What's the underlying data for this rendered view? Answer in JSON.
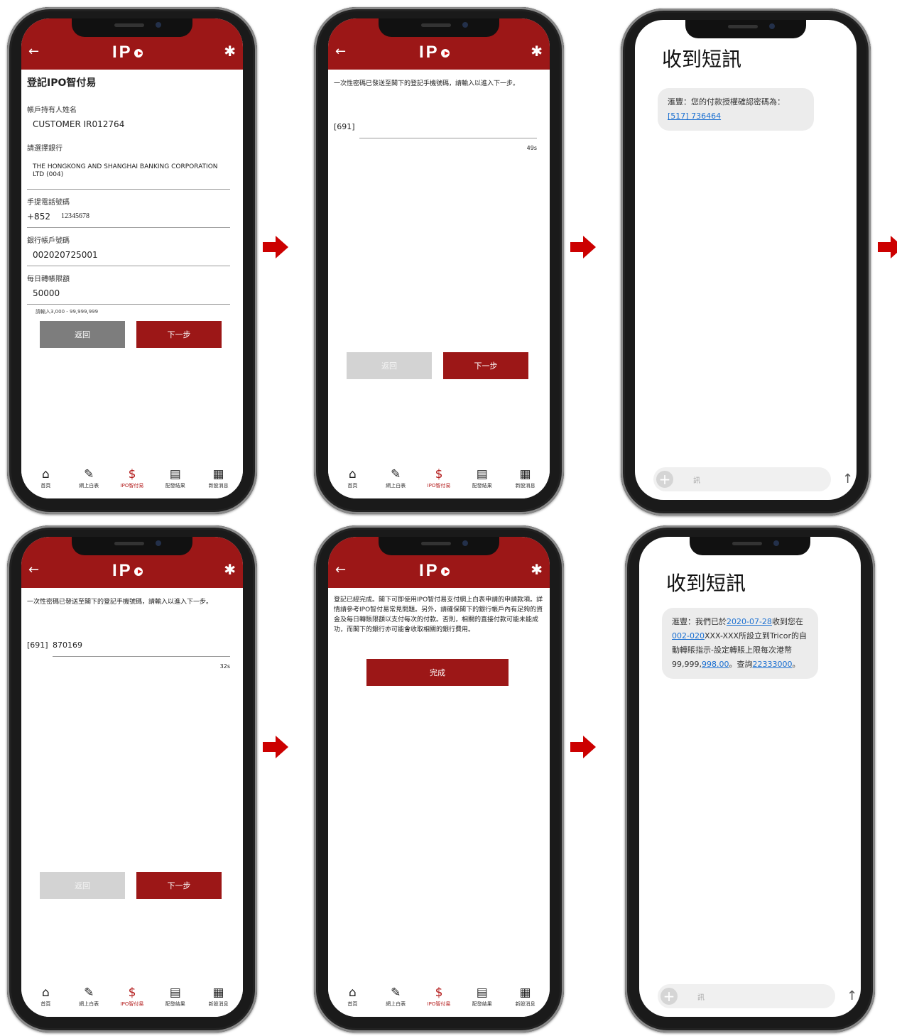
{
  "app": {
    "logo_text": "IP",
    "back_icon": "arrow-left-icon",
    "settings_icon": "gear-icon",
    "brand_color": "#9c1717"
  },
  "tabs": [
    {
      "icon": "home-icon",
      "glyph": "⌂",
      "label": "首頁"
    },
    {
      "icon": "pencil-icon",
      "glyph": "✎",
      "label": "網上白表"
    },
    {
      "icon": "dollar-icon",
      "glyph": "$",
      "label": "IPO智付易"
    },
    {
      "icon": "clipboard-icon",
      "glyph": "▤",
      "label": "配發結果"
    },
    {
      "icon": "newspaper-icon",
      "glyph": "▦",
      "label": "新股消息"
    }
  ],
  "screen1": {
    "title": "登記IPO智付易",
    "holder_label": "帳戶持有人姓名",
    "holder_value": "CUSTOMER IR012764",
    "bank_label": "請選擇銀行",
    "bank_value": "THE HONGKONG AND SHANGHAI BANKING CORPORATION LTD (004)",
    "phone_label": "手提電話號碼",
    "phone_prefix": "+852",
    "phone_value": "12345678",
    "account_label": "銀行帳戶號碼",
    "account_value": "002020725001",
    "limit_label": "每日轉帳限額",
    "limit_value": "50000",
    "limit_hint": "請輸入3,000 - 99,999,999",
    "back_label": "返回",
    "next_label": "下一步"
  },
  "screen2": {
    "instruction": "一次性密碼已發送至閣下的登記手機號碼，請輸入以進入下一步。",
    "otp_prefix": "[691]",
    "otp_value": "",
    "timer": "49s",
    "back_label": "返回",
    "next_label": "下一步"
  },
  "screen3": {
    "title": "收到短訊",
    "message_text": "滙豐：您的付款授權確認密碼為：",
    "message_code": "[517] 736464",
    "input_placeholder": "訊"
  },
  "screen4": {
    "instruction": "一次性密碼已發送至閣下的登記手機號碼，請輸入以進入下一步。",
    "otp_prefix": "[691]",
    "otp_value": "870169",
    "timer": "32s",
    "back_label": "返回",
    "next_label": "下一步"
  },
  "screen5": {
    "completion_text": "登記已經完成。閣下可即使用IPO智付易支付網上白表申請的申請款項。詳情請參考IPO智付易常見問題。另外，請確保閣下的銀行帳戶內有足夠的資金及每日轉賬限額以支付每次的付款。否則，相關的直接付款可能未能成功，而閣下的銀行亦可能會收取相關的銀行費用。",
    "done_label": "完成"
  },
  "screen6": {
    "title": "收到短訊",
    "msg_part1": "滙豐：我們已於",
    "msg_date": "2020-07-28",
    "msg_part2": "收到您在",
    "msg_acct": "002-020",
    "msg_part3": "XXX-XXX所設立到Tricor的自動轉賬指示-設定轉賬上限每次港幣99,999,",
    "msg_amount": "998.00",
    "msg_part4": "。查詢",
    "msg_phone": "22333000",
    "msg_part5": "。",
    "input_placeholder": "訊"
  },
  "flow_arrow_color": "#cc0000"
}
